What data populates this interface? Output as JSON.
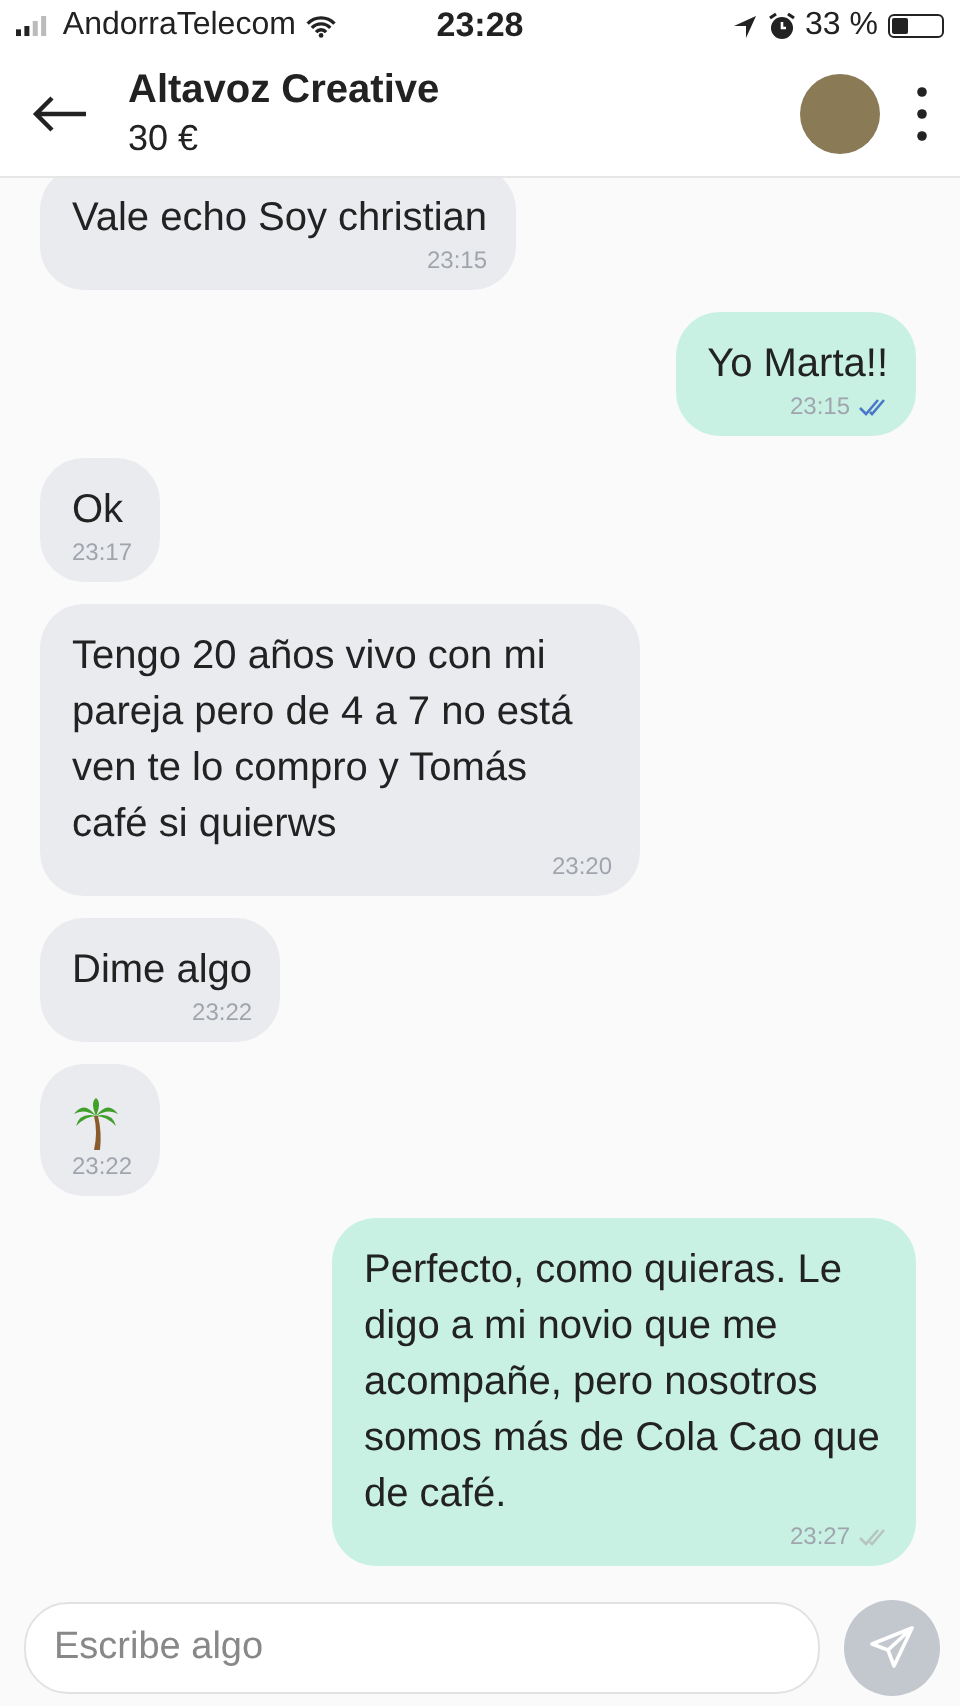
{
  "status_bar": {
    "carrier": "AndorraTelecom",
    "time": "23:28",
    "battery": "33 %"
  },
  "header": {
    "title": "Altavoz Creative",
    "subtitle": "30 €"
  },
  "messages": [
    {
      "kind": "text",
      "outgoing": false,
      "text": "Vale echo Soy christian",
      "time": "23:15"
    },
    {
      "kind": "text",
      "outgoing": true,
      "text": "Yo Marta!!",
      "time": "23:15",
      "read": true
    },
    {
      "kind": "text",
      "outgoing": false,
      "text": "Ok",
      "time": "23:17"
    },
    {
      "kind": "text",
      "outgoing": false,
      "text": "Tengo 20 años vivo con mi pareja pero de 4 a 7 no está ven te lo compro y Tomás café si quierws",
      "time": "23:20"
    },
    {
      "kind": "text",
      "outgoing": false,
      "text": "Dime algo",
      "time": "23:22"
    },
    {
      "kind": "palm",
      "outgoing": false,
      "time": "23:22"
    },
    {
      "kind": "text",
      "outgoing": true,
      "text": "Perfecto, como quieras. Le digo a mi novio que me acompañe, pero nosotros somos más de Cola Cao que de café.",
      "time": "23:27",
      "read": false
    }
  ],
  "composer": {
    "placeholder": "Escribe algo"
  }
}
